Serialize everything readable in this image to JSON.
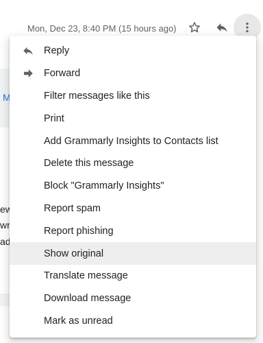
{
  "email_header": {
    "timestamp": "Mon, Dec 23, 8:40 PM (15 hours ago)",
    "icons": [
      "star-icon",
      "reply-icon",
      "more-vert-icon"
    ]
  },
  "background_fragments": {
    "link_char": "M",
    "text_lines": [
      "ew",
      "wr",
      "ad"
    ]
  },
  "menu": {
    "items": [
      {
        "label": "Reply",
        "icon": "reply-icon"
      },
      {
        "label": "Forward",
        "icon": "forward-icon"
      },
      {
        "label": "Filter messages like this"
      },
      {
        "label": "Print"
      },
      {
        "label": "Add Grammarly Insights to Contacts list"
      },
      {
        "label": "Delete this message"
      },
      {
        "label": "Block \"Grammarly Insights\""
      },
      {
        "label": "Report spam"
      },
      {
        "label": "Report phishing"
      },
      {
        "label": "Show original",
        "state": "hovered"
      },
      {
        "label": "Translate message"
      },
      {
        "label": "Download message"
      },
      {
        "label": "Mark as unread"
      }
    ]
  },
  "colors": {
    "text": "#202124",
    "secondary_text": "#5f6368",
    "hover_bg": "#eeeeee",
    "link": "#1a73e8"
  }
}
